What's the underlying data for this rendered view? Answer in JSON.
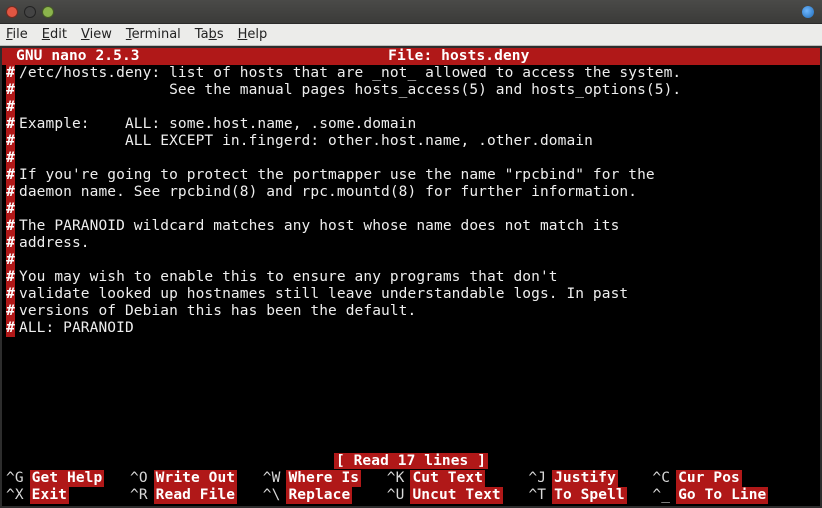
{
  "window": {
    "close": "●",
    "min": "●",
    "max": "●"
  },
  "menus": {
    "file": {
      "u": "F",
      "rest": "ile"
    },
    "edit": {
      "u": "E",
      "rest": "dit"
    },
    "view": {
      "u": "V",
      "rest": "iew"
    },
    "term": {
      "u": "T",
      "rest": "erminal"
    },
    "tabs": {
      "u": "",
      "rest": "Ta",
      "u2": "b",
      "rest2": "s"
    },
    "help": {
      "u": "H",
      "rest": "elp"
    }
  },
  "nano": {
    "version": "GNU nano 2.5.3",
    "file_label": "File: hosts.deny"
  },
  "file_lines": [
    "/etc/hosts.deny: list of hosts that are _not_ allowed to access the system.",
    "                 See the manual pages hosts_access(5) and hosts_options(5).",
    "",
    "Example:    ALL: some.host.name, .some.domain",
    "            ALL EXCEPT in.fingerd: other.host.name, .other.domain",
    "",
    "If you're going to protect the portmapper use the name \"rpcbind\" for the",
    "daemon name. See rpcbind(8) and rpc.mountd(8) for further information.",
    "",
    "The PARANOID wildcard matches any host whose name does not match its",
    "address.",
    "",
    "You may wish to enable this to ensure any programs that don't",
    "validate looked up hostnames still leave understandable logs. In past",
    "versions of Debian this has been the default.",
    "ALL: PARANOID"
  ],
  "gutter_char": "#",
  "status": "[ Read 17 lines ]",
  "shortcuts_row1": [
    {
      "key": "^G",
      "label": "Get Help"
    },
    {
      "key": "^O",
      "label": "Write Out"
    },
    {
      "key": "^W",
      "label": "Where Is"
    },
    {
      "key": "^K",
      "label": "Cut Text"
    },
    {
      "key": "^J",
      "label": "Justify"
    },
    {
      "key": "^C",
      "label": "Cur Pos"
    }
  ],
  "shortcuts_row2": [
    {
      "key": "^X",
      "label": "Exit"
    },
    {
      "key": "^R",
      "label": "Read File"
    },
    {
      "key": "^\\",
      "label": "Replace"
    },
    {
      "key": "^U",
      "label": "Uncut Text"
    },
    {
      "key": "^T",
      "label": "To Spell"
    },
    {
      "key": "^_",
      "label": "Go To Line"
    }
  ]
}
